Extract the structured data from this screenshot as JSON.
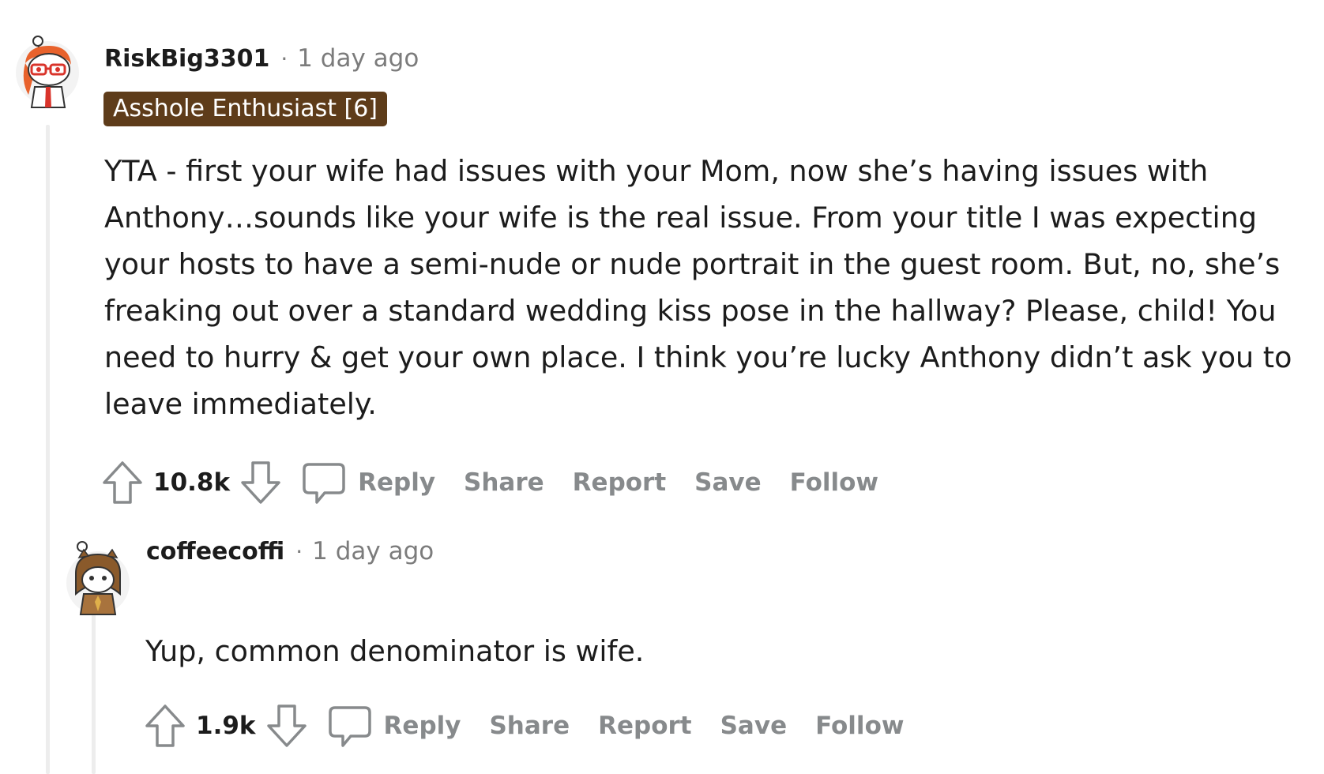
{
  "comments": [
    {
      "username": "RiskBig3301",
      "separator": "·",
      "time": "1 day ago",
      "flair": "Asshole Enthusiast [6]",
      "flair_color": "#5e3c1a",
      "body": "YTA - first your wife had issues with your Mom, now she’s having issues with Anthony…sounds like your wife is the real issue. From your title I was expecting your hosts to have a semi-nude or nude portrait in the guest room. But, no, she’s freaking out over a standard wedding kiss pose in the hallway? Please, child! You need to hurry & get your own place. I think you’re lucky Anthony didn’t ask you to leave immediately.",
      "score": "10.8k",
      "actions": [
        "Reply",
        "Share",
        "Report",
        "Save",
        "Follow"
      ]
    },
    {
      "username": "coffeecoffi",
      "separator": "·",
      "time": "1 day ago",
      "body": "Yup, common denominator is wife.",
      "score": "1.9k",
      "actions": [
        "Reply",
        "Share",
        "Report",
        "Save",
        "Follow"
      ]
    }
  ],
  "icons": {
    "upvote": "arrow-up-outline",
    "downvote": "arrow-down-outline",
    "reply": "speech-bubble"
  },
  "colors": {
    "meta_gray": "#7c7c7c",
    "action_gray": "#878a8c",
    "text": "#1c1c1c"
  }
}
